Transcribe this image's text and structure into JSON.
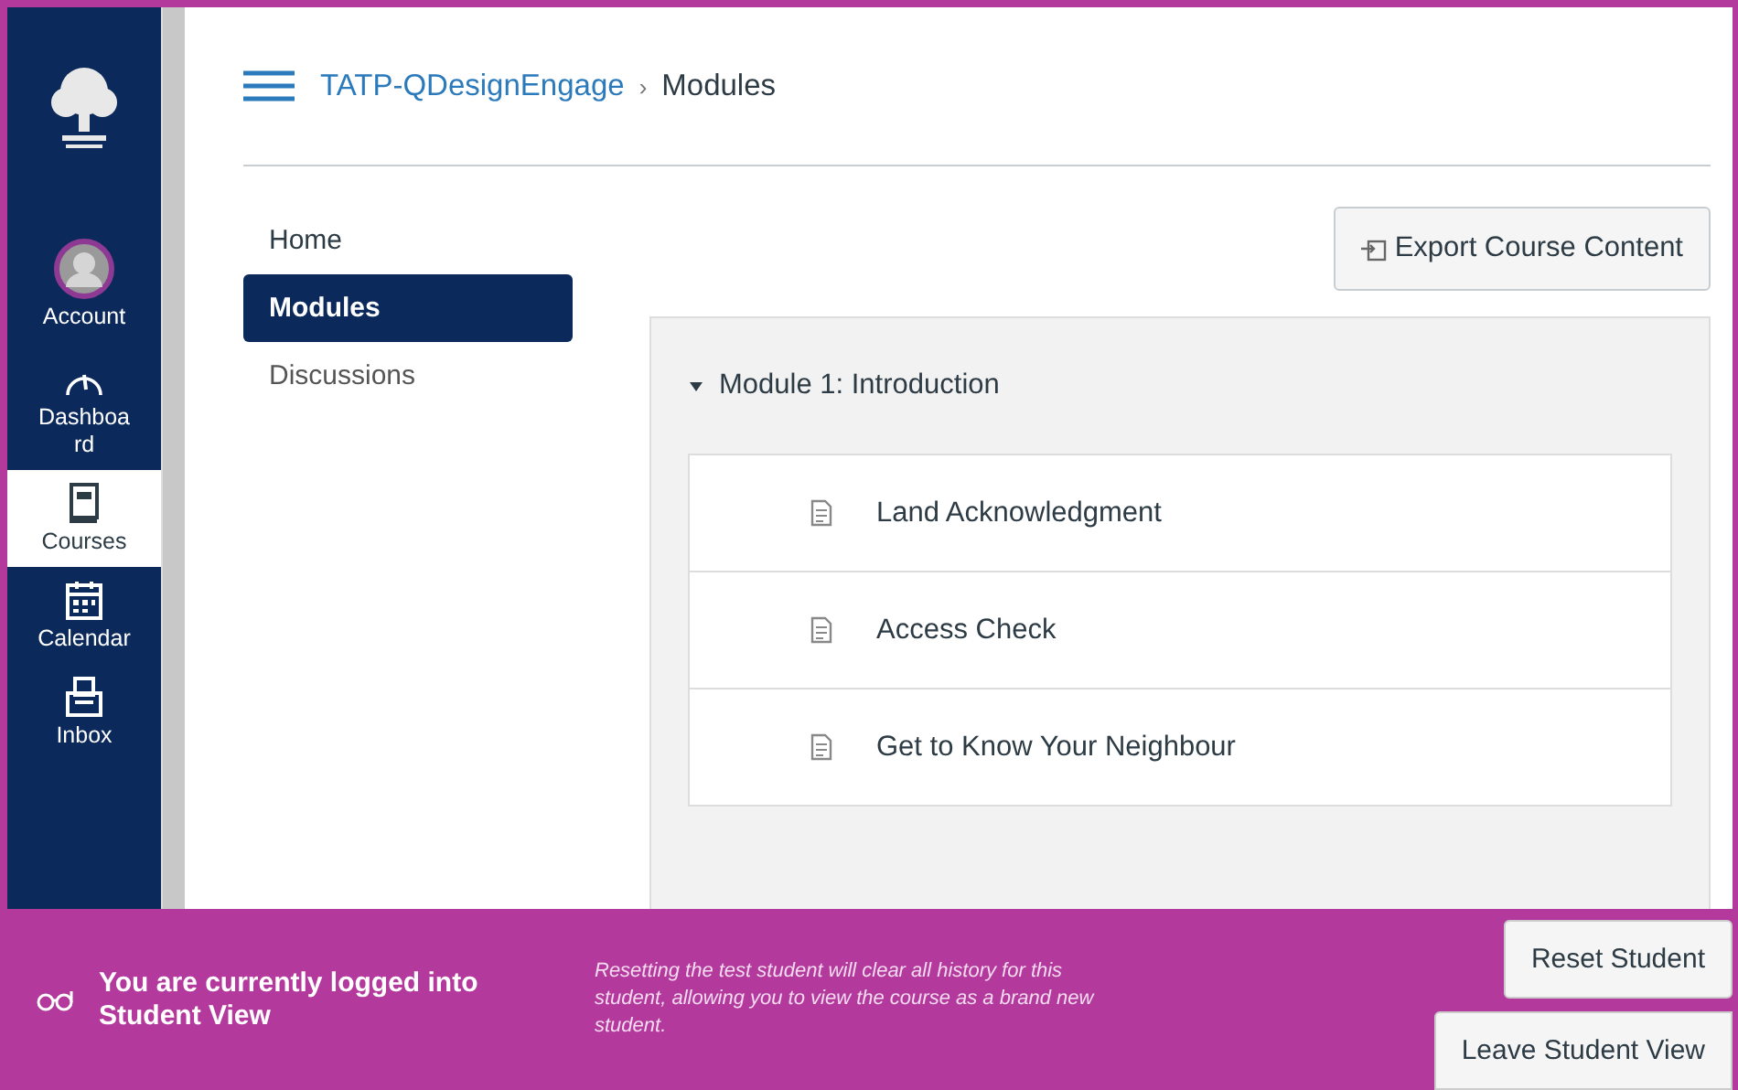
{
  "global_nav": [
    {
      "label": "Account",
      "kind": "avatar",
      "selected": false
    },
    {
      "label": "Dashboard",
      "kind": "gauge",
      "selected": false
    },
    {
      "label": "Courses",
      "kind": "book",
      "selected": true
    },
    {
      "label": "Calendar",
      "kind": "calendar",
      "selected": false
    },
    {
      "label": "Inbox",
      "kind": "inbox",
      "selected": false
    }
  ],
  "breadcrumb": {
    "separator": "›",
    "items": [
      "TATP-QDesignEngage",
      "Modules"
    ]
  },
  "course_nav": [
    {
      "label": "Home",
      "selected": false
    },
    {
      "label": "Modules",
      "selected": true
    },
    {
      "label": "Discussions",
      "selected": false
    }
  ],
  "export_button": "Export Course Content",
  "module": {
    "title": "Module 1: Introduction",
    "expanded": true,
    "items": [
      "Land Acknowledgment",
      "Access Check",
      "Get to Know Your Neighbour"
    ]
  },
  "student_view": {
    "message": "You are currently logged into Student View",
    "note": "Resetting the test student will clear all history for this student, allowing you to view the course as a brand new student.",
    "buttons": [
      "Reset Student",
      "Leave Student View"
    ]
  }
}
